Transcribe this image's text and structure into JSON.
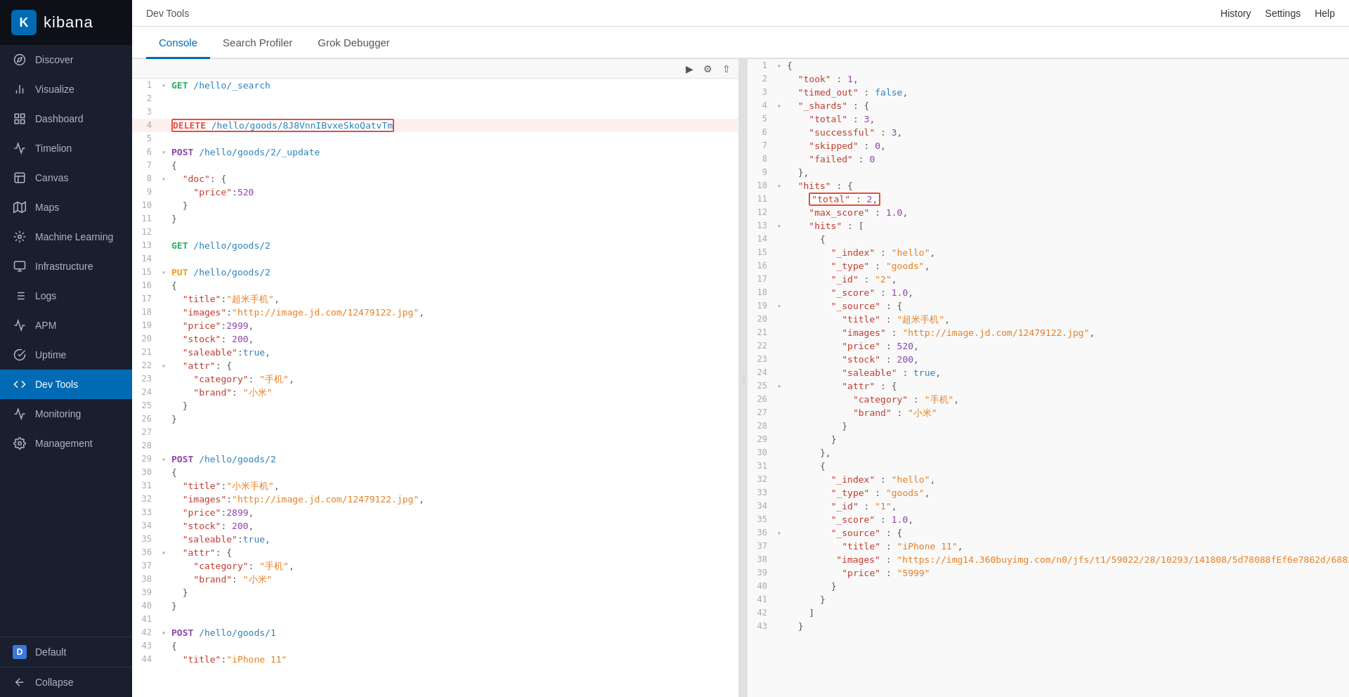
{
  "app": {
    "title": "kibana",
    "logo_letter": "K"
  },
  "topbar": {
    "title": "Dev Tools",
    "history": "History",
    "settings": "Settings",
    "help": "Help"
  },
  "tabs": [
    {
      "label": "Console",
      "active": true
    },
    {
      "label": "Search Profiler",
      "active": false
    },
    {
      "label": "Grok Debugger",
      "active": false
    }
  ],
  "sidebar": {
    "items": [
      {
        "label": "Discover",
        "icon": "compass"
      },
      {
        "label": "Visualize",
        "icon": "bar-chart"
      },
      {
        "label": "Dashboard",
        "icon": "grid"
      },
      {
        "label": "Timelion",
        "icon": "timelion"
      },
      {
        "label": "Canvas",
        "icon": "canvas"
      },
      {
        "label": "Maps",
        "icon": "map"
      },
      {
        "label": "Machine Learning",
        "icon": "ml"
      },
      {
        "label": "Infrastructure",
        "icon": "infra"
      },
      {
        "label": "Logs",
        "icon": "logs"
      },
      {
        "label": "APM",
        "icon": "apm"
      },
      {
        "label": "Uptime",
        "icon": "uptime"
      },
      {
        "label": "Dev Tools",
        "icon": "devtools",
        "active": true
      },
      {
        "label": "Monitoring",
        "icon": "monitoring"
      },
      {
        "label": "Management",
        "icon": "management"
      }
    ],
    "bottom": [
      {
        "label": "Default",
        "icon": "D"
      },
      {
        "label": "Collapse",
        "icon": "arrow-left"
      }
    ]
  }
}
